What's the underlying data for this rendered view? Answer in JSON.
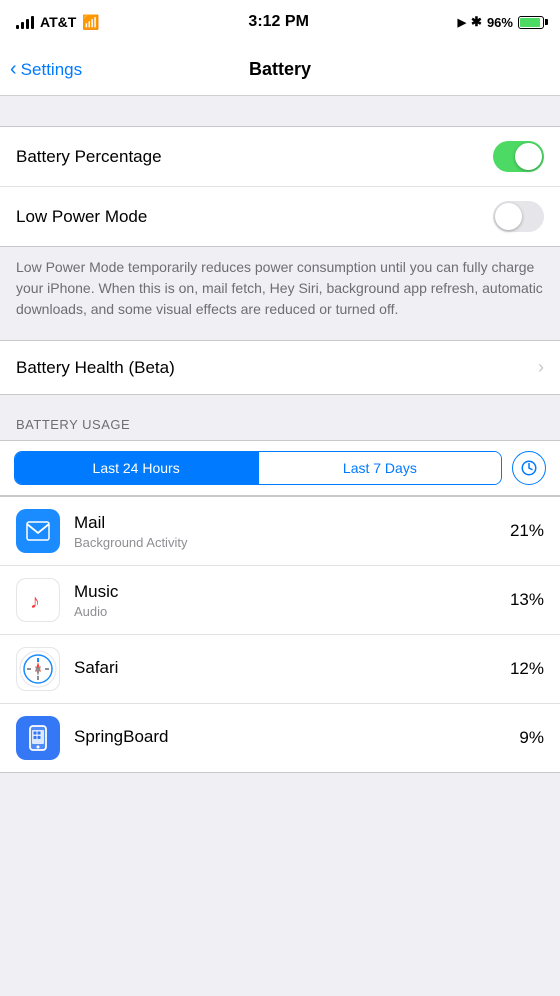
{
  "statusBar": {
    "carrier": "AT&T",
    "time": "3:12 PM",
    "battery_percent": "96%",
    "location_icon": "▶",
    "bluetooth_icon": "B"
  },
  "navBar": {
    "back_label": "Settings",
    "title": "Battery"
  },
  "settings": {
    "battery_percentage_label": "Battery Percentage",
    "battery_percentage_on": true,
    "low_power_mode_label": "Low Power Mode",
    "low_power_mode_on": false,
    "low_power_description": "Low Power Mode temporarily reduces power consumption until you can fully charge your iPhone. When this is on, mail fetch, Hey Siri, background app refresh, automatic downloads, and some visual effects are reduced or turned off.",
    "battery_health_label": "Battery Health (Beta)"
  },
  "batteryUsage": {
    "section_header": "BATTERY USAGE",
    "segment_last24": "Last 24 Hours",
    "segment_last7": "Last 7 Days",
    "apps": [
      {
        "name": "Mail",
        "subtitle": "Background Activity",
        "percent": "21%",
        "icon_type": "mail"
      },
      {
        "name": "Music",
        "subtitle": "Audio",
        "percent": "13%",
        "icon_type": "music"
      },
      {
        "name": "Safari",
        "subtitle": "",
        "percent": "12%",
        "icon_type": "safari"
      },
      {
        "name": "SpringBoard",
        "subtitle": "",
        "percent": "9%",
        "icon_type": "springboard"
      }
    ]
  },
  "colors": {
    "ios_blue": "#007aff",
    "ios_green": "#4cd964",
    "ios_gray": "#8e8e93"
  }
}
